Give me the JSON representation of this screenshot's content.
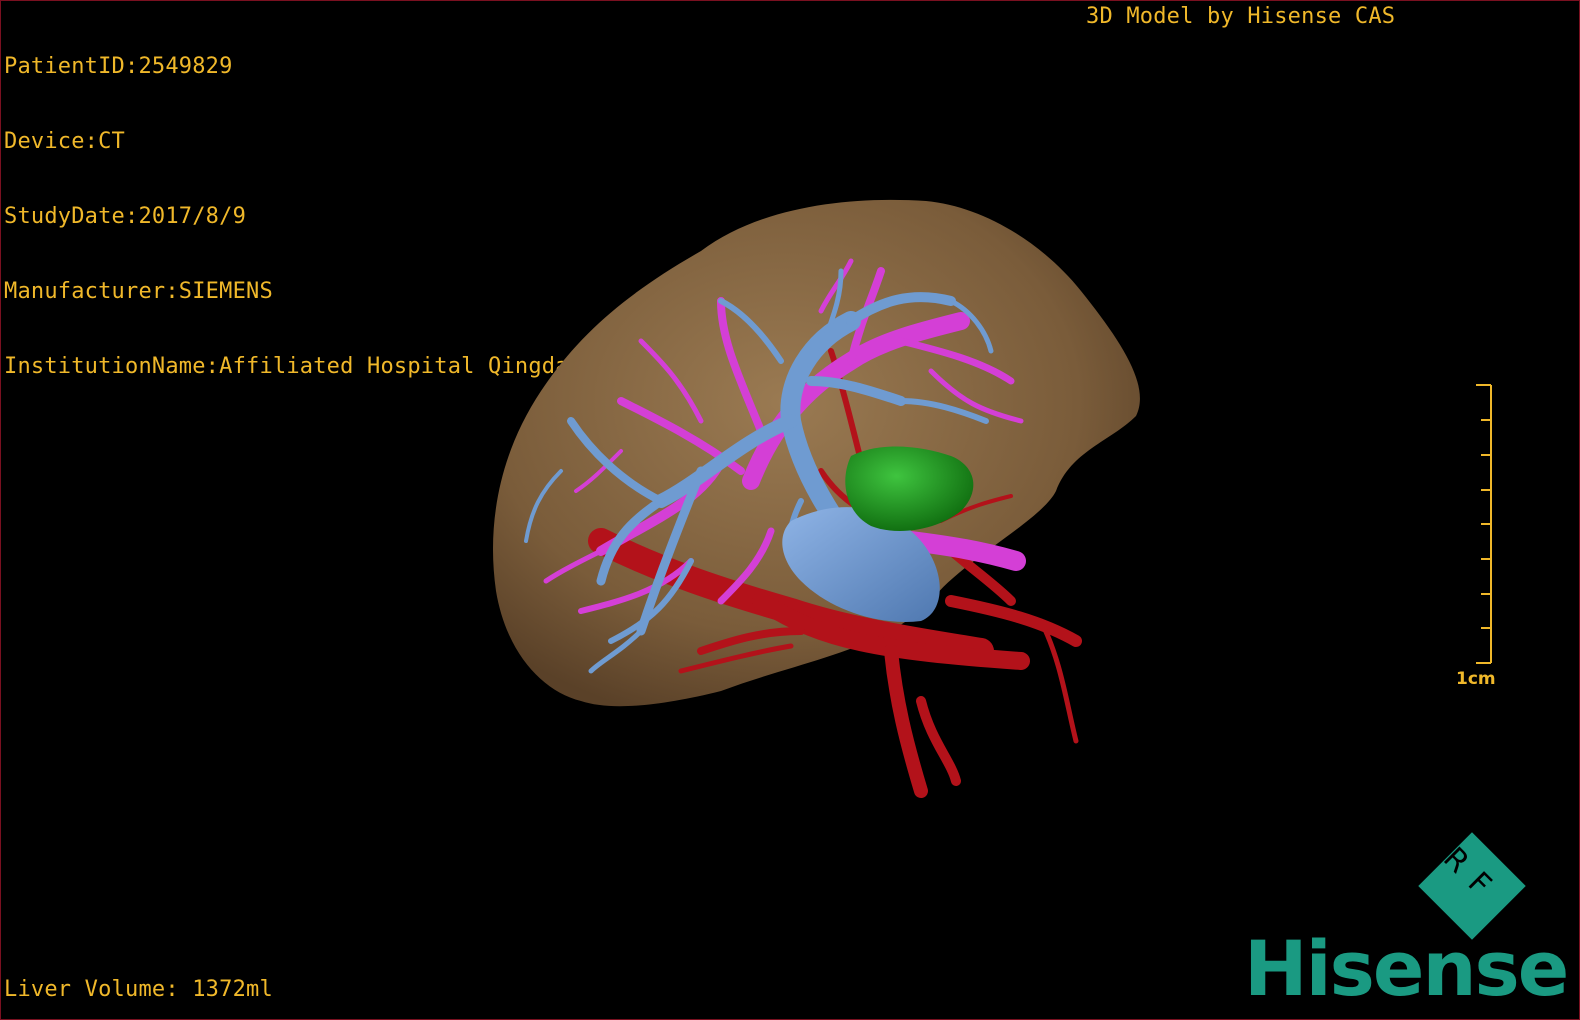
{
  "info": {
    "patient_id": "PatientID:2549829",
    "device": "Device:CT",
    "study_date": "StudyDate:2017/8/9",
    "manufacturer": "Manufacturer:SIEMENS",
    "institution": "InstitutionName:Affiliated Hospital Qingdao University-C"
  },
  "credit": "3D Model by Hisense CAS",
  "footer": {
    "liver_volume": "Liver Volume: 1372ml"
  },
  "scale": {
    "label": "1cm",
    "ticks": 9
  },
  "brand": {
    "name": "Hisense",
    "badge": "RF",
    "color": "#1a9a82"
  },
  "colors": {
    "overlay_text": "#f0b82a",
    "liver": "#8a6a45",
    "portal_vein": "#6f9bd1",
    "hepatic_vein": "#d43fd6",
    "artery": "#b3121a",
    "tumor": "#1a8a1a"
  },
  "model": {
    "structures": [
      "liver",
      "portal-vein",
      "hepatic-vein",
      "artery",
      "tumor",
      "vena-cava"
    ]
  }
}
